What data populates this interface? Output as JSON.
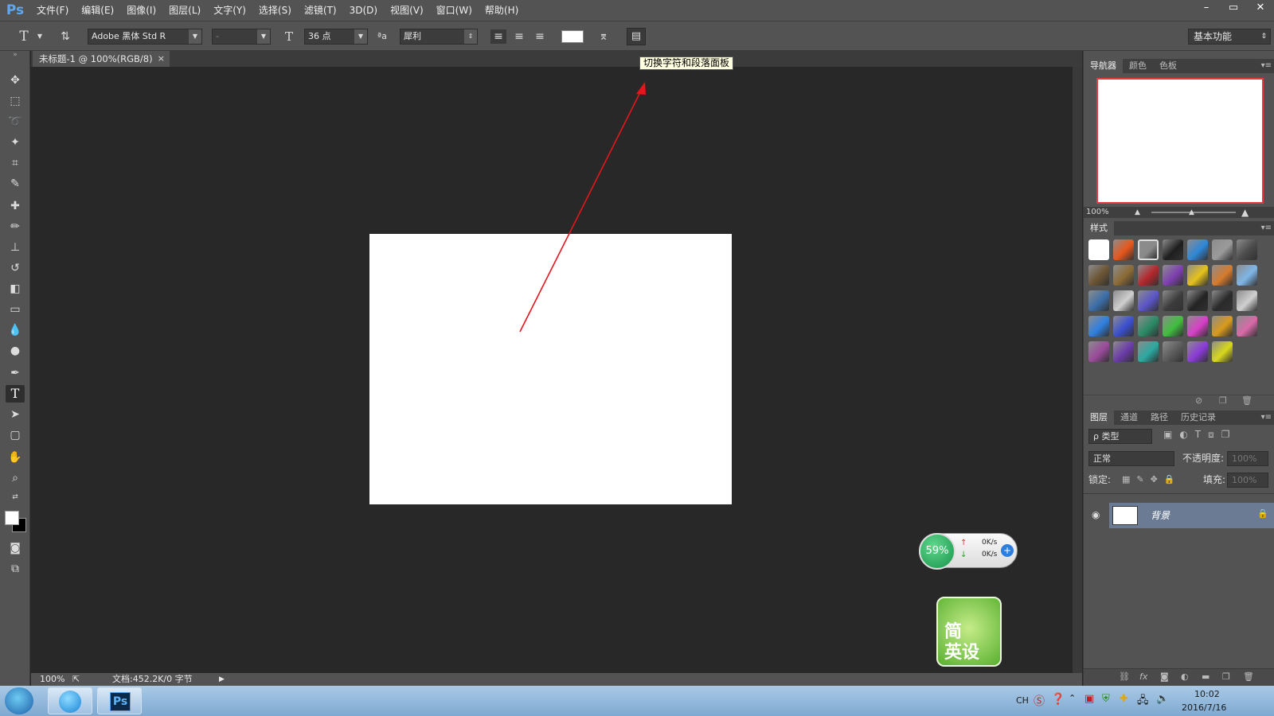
{
  "app": {
    "logo": "Ps"
  },
  "menu": [
    "文件(F)",
    "编辑(E)",
    "图像(I)",
    "图层(L)",
    "文字(Y)",
    "选择(S)",
    "滤镜(T)",
    "3D(D)",
    "视图(V)",
    "窗口(W)",
    "帮助(H)"
  ],
  "window_controls": {
    "minimize": "–",
    "restore": "▭",
    "close": "✕"
  },
  "options": {
    "font_family": "Adobe 黑体 Std R",
    "font_style": "-",
    "font_size": "36 点",
    "aa_label": "ªa",
    "antialias": "犀利",
    "workspace": "基本功能"
  },
  "tooltip": "切换字符和段落面板",
  "document": {
    "tab_title": "未标题-1 @ 100%(RGB/8)",
    "tab_close": "×",
    "zoom": "100%",
    "doc_info": "文档:452.2K/0 字节"
  },
  "navigator": {
    "tabs": [
      "导航器",
      "颜色",
      "色板"
    ],
    "zoom": "100%"
  },
  "styles": {
    "title": "样式",
    "swatch_colors": [
      "#ffffff",
      "#e8561c",
      "#8a8a8a",
      "#1e1e1e",
      "#2e87d8",
      "#9a9a9a",
      "#4a4a4a",
      "#6b5433",
      "#8b6a35",
      "#b3262b",
      "#7e3fb0",
      "#e6c21a",
      "#d77b2d",
      "#7fb6e8",
      "#3a6ea8",
      "#cfcfcf",
      "#5a55c8",
      "#3c3c3c",
      "#232323",
      "#2a2a2a",
      "#d0d0d0",
      "#2f7fe0",
      "#3a4fd0",
      "#2a8a66",
      "#3fbf3f",
      "#d83fc6",
      "#d99a1a",
      "#d86aa8",
      "#9a4a9a",
      "#6a3aa8",
      "#2aa8a0",
      "#5a5a5a",
      "#8a3ad8",
      "#d8d81a"
    ]
  },
  "layers": {
    "tabs": [
      "图层",
      "通道",
      "路径",
      "历史记录"
    ],
    "filter": "ρ 类型",
    "blend_mode": "正常",
    "opacity_label": "不透明度:",
    "opacity_value": "100%",
    "lock_label": "锁定:",
    "fill_label": "填充:",
    "fill_value": "100%",
    "items": [
      {
        "name": "背景"
      }
    ]
  },
  "net_widget": {
    "cpu": "59%",
    "up": "0K/s",
    "down": "0K/s"
  },
  "app_widget": {
    "line1": "简",
    "line2": "英设"
  },
  "taskbar": {
    "ps_label": "Ps",
    "lang": "CH",
    "time": "10:02",
    "date": "2016/7/16"
  }
}
